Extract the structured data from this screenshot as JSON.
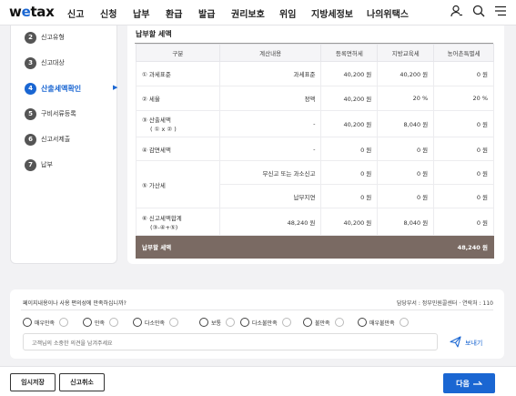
{
  "header": {
    "logo_pre": "w",
    "logo_o": "e",
    "logo_post": "tax",
    "nav": [
      "신고",
      "신청",
      "납부",
      "환급",
      "발급",
      "권리보호",
      "위임",
      "지방세정보",
      "나의위택스"
    ]
  },
  "sidebar": {
    "steps": [
      {
        "num": "2",
        "label": "신고유형"
      },
      {
        "num": "3",
        "label": "신고대상"
      },
      {
        "num": "4",
        "label": "산출세액확인",
        "active": true
      },
      {
        "num": "5",
        "label": "구비서류등록"
      },
      {
        "num": "6",
        "label": "신고서제출"
      },
      {
        "num": "7",
        "label": "납부"
      }
    ]
  },
  "main": {
    "section_title": "납부할 세액",
    "headers": [
      "구분",
      "계산내용",
      "등록면허세",
      "지방교육세",
      "농어촌특별세"
    ],
    "rows": [
      {
        "label": "① 과세표준",
        "calc": "과세표준",
        "a": "40,200 원",
        "b": "40,200 원",
        "c": "0 원"
      },
      {
        "label": "② 세율",
        "calc": "정액",
        "a": "40,200 원",
        "b": "20 %",
        "c": "20 %"
      },
      {
        "label1": "③ 산출세액",
        "label2": "( ① x ② )",
        "calc": "-",
        "a": "40,200 원",
        "b": "8,040 원",
        "c": "0 원"
      },
      {
        "label": "④ 감면세액",
        "calc": "-",
        "a": "0 원",
        "b": "0 원",
        "c": "0 원"
      },
      {
        "label": "⑤ 가산세",
        "calc1": "무신고 또는 과소신고",
        "a1": "0 원",
        "b1": "0 원",
        "c1": "0 원",
        "calc2": "납부지연",
        "a2": "0 원",
        "b2": "0 원",
        "c2": "0 원"
      },
      {
        "label1": "⑥ 신고세액합계",
        "label2": "(③-④+⑤)",
        "calc": "48,240 원",
        "a": "40,200 원",
        "b": "8,040 원",
        "c": "0 원"
      }
    ],
    "total_label": "납부할 세액",
    "total_value": "48,240 원"
  },
  "feedback": {
    "question": "페이지내용이나 사용 편의성에 만족하십니까?",
    "meta": "담당부서 : 정부민원콜센터 · 연락처 : 110",
    "ratings": [
      "매우만족",
      "만족",
      "다소만족",
      "보통",
      "다소불만족",
      "불만족",
      "매우불만족"
    ],
    "placeholder": "고객님의 소중한 의견을 남겨주세요",
    "send": "보내기"
  },
  "footer": {
    "temp_save": "임시저장",
    "cancel": "신고취소",
    "next": "다음"
  }
}
